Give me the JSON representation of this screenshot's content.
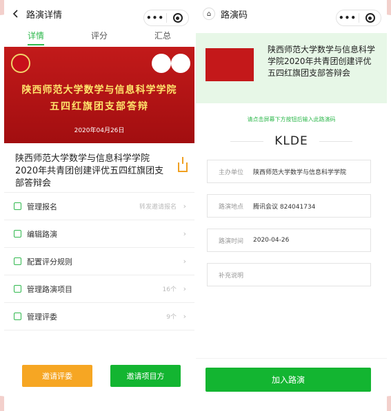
{
  "left": {
    "nav_title": "路演详情",
    "tabs": [
      "详情",
      "评分",
      "汇总"
    ],
    "banner": {
      "line1": "陕西师范大学数学与信息科学学院",
      "line2": "五四红旗团支部答辩",
      "date": "2020年04月26日"
    },
    "title": "陕西师范大学数学与信息科学学院2020年共青团创建评优五四红旗团支部答辩会",
    "menu": [
      {
        "label": "管理报名",
        "extra": "转发邀请报名",
        "icon": "checkbox-icon"
      },
      {
        "label": "编辑路演",
        "extra": "",
        "icon": "edit-icon"
      },
      {
        "label": "配置评分规则",
        "extra": "",
        "icon": "list-icon"
      },
      {
        "label": "管理路演项目",
        "extra": "16个",
        "icon": "grid-icon"
      },
      {
        "label": "管理评委",
        "extra": "9个",
        "icon": "users-icon"
      }
    ],
    "buttons": {
      "invite_judges": "邀请评委",
      "invite_projects": "邀请项目方"
    }
  },
  "right": {
    "nav_title": "路演码",
    "hero_title": "陕西师范大学数学与信息科学学院2020年共青团创建评优五四红旗团支部答辩会",
    "hint": "请点击屏幕下方按钮后输入此路演码",
    "code": "KLDE",
    "fields": [
      {
        "label": "主办单位",
        "value": "陕西师范大学数学与信息科学学院"
      },
      {
        "label": "路演地点",
        "value": "腾讯会议 824041734"
      },
      {
        "label": "路演时间",
        "value": "2020-04-26"
      },
      {
        "label": "补充说明",
        "value": ""
      }
    ],
    "join_button": "加入路演"
  },
  "colors": {
    "accent_green": "#13b531",
    "orange": "#f6a623",
    "banner_red": "#c21a1a"
  }
}
